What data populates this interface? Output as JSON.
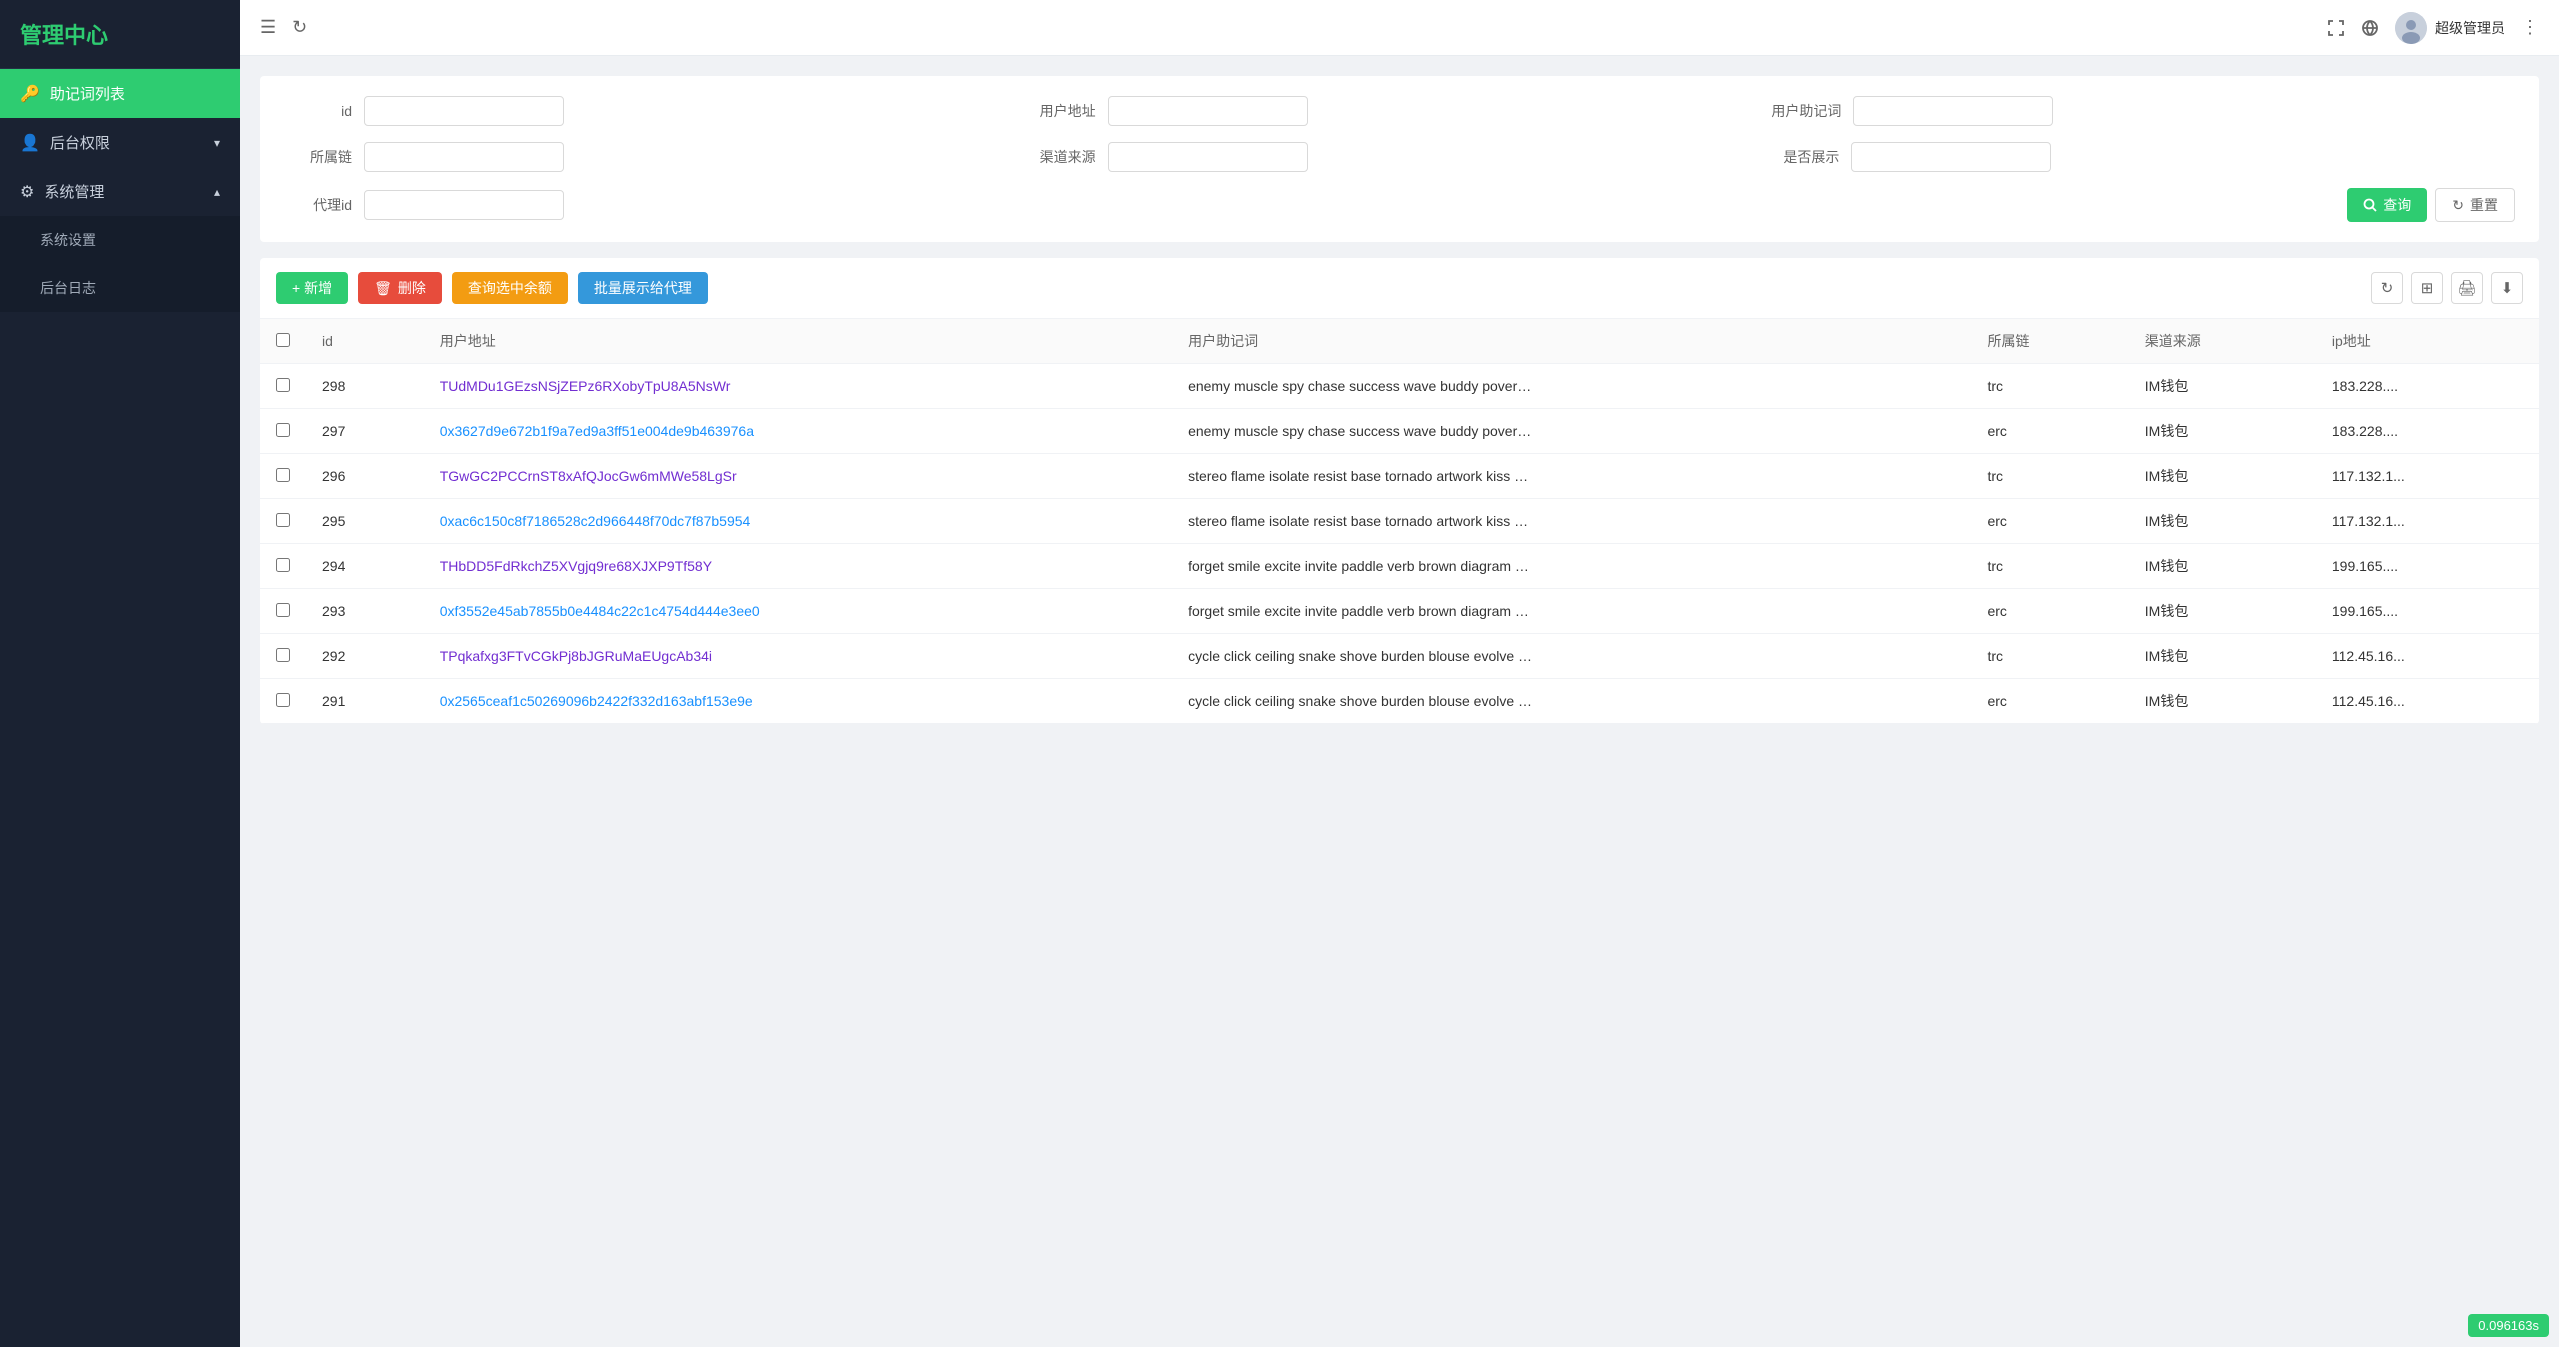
{
  "app": {
    "title": "管理中心"
  },
  "header": {
    "expand_icon": "☰",
    "refresh_icon": "↻",
    "fullscreen_icon": "⛶",
    "globe_icon": "🌐",
    "more_icon": "⋮",
    "user_name": "超级管理员"
  },
  "sidebar": {
    "logo": "管理中心",
    "items": [
      {
        "id": "mnemonic-list",
        "label": "助记词列表",
        "icon": "🔑",
        "active": true,
        "has_arrow": false
      },
      {
        "id": "backend-perm",
        "label": "后台权限",
        "icon": "👤",
        "active": false,
        "has_arrow": true,
        "expanded": false
      },
      {
        "id": "sys-manage",
        "label": "系统管理",
        "icon": "⚙",
        "active": false,
        "has_arrow": true,
        "expanded": true
      }
    ],
    "sub_items": [
      {
        "id": "sys-settings",
        "label": "系统设置"
      },
      {
        "id": "backend-log",
        "label": "后台日志"
      }
    ]
  },
  "search_form": {
    "fields": [
      {
        "id": "field-id",
        "label": "id",
        "placeholder": ""
      },
      {
        "id": "field-user-addr",
        "label": "用户地址",
        "placeholder": ""
      },
      {
        "id": "field-user-mnemonic",
        "label": "用户助记词",
        "placeholder": ""
      },
      {
        "id": "field-chain",
        "label": "所属链",
        "placeholder": ""
      },
      {
        "id": "field-channel",
        "label": "渠道来源",
        "placeholder": ""
      },
      {
        "id": "field-display",
        "label": "是否展示",
        "placeholder": ""
      },
      {
        "id": "field-agent-id",
        "label": "代理id",
        "placeholder": ""
      }
    ],
    "query_btn": "查询",
    "reset_btn": "重置"
  },
  "toolbar": {
    "add_btn": "+ 新增",
    "delete_btn": "删除",
    "query_selected_btn": "查询选中余额",
    "batch_display_btn": "批量展示给代理"
  },
  "table": {
    "columns": [
      "id",
      "用户地址",
      "用户助记词",
      "所属链",
      "渠道来源",
      "ip地址"
    ],
    "rows": [
      {
        "id": "298",
        "user_addr": "TUdMDu1GEzsNSjZEPz6RXobyTpU8A5NsWr",
        "mnemonic": "enemy muscle spy chase success wave buddy pover…",
        "chain": "trc",
        "channel": "IM钱包",
        "ip": "183.228...."
      },
      {
        "id": "297",
        "user_addr": "0x3627d9e672b1f9a7ed9a3ff51e004de9b463976a",
        "mnemonic": "enemy muscle spy chase success wave buddy pover…",
        "chain": "erc",
        "channel": "IM钱包",
        "ip": "183.228...."
      },
      {
        "id": "296",
        "user_addr": "TGwGC2PCCrnST8xAfQJocGw6mMWe58LgSr",
        "mnemonic": "stereo flame isolate resist base tornado artwork kiss …",
        "chain": "trc",
        "channel": "IM钱包",
        "ip": "117.132.1..."
      },
      {
        "id": "295",
        "user_addr": "0xac6c150c8f7186528c2d966448f70dc7f87b5954",
        "mnemonic": "stereo flame isolate resist base tornado artwork kiss …",
        "chain": "erc",
        "channel": "IM钱包",
        "ip": "117.132.1..."
      },
      {
        "id": "294",
        "user_addr": "THbDD5FdRkchZ5XVgjq9re68XJXP9Tf58Y",
        "mnemonic": "forget smile excite invite paddle verb brown diagram …",
        "chain": "trc",
        "channel": "IM钱包",
        "ip": "199.165...."
      },
      {
        "id": "293",
        "user_addr": "0xf3552e45ab7855b0e4484c22c1c4754d444e3ee0",
        "mnemonic": "forget smile excite invite paddle verb brown diagram …",
        "chain": "erc",
        "channel": "IM钱包",
        "ip": "199.165...."
      },
      {
        "id": "292",
        "user_addr": "TPqkafxg3FTvCGkPj8bJGRuMaEUgcAb34i",
        "mnemonic": "cycle click ceiling snake shove burden blouse evolve …",
        "chain": "trc",
        "channel": "IM钱包",
        "ip": "112.45.16..."
      },
      {
        "id": "291",
        "user_addr": "0x2565ceaf1c50269096b2422f332d163abf153e9e",
        "mnemonic": "cycle click ceiling snake shove burden blouse evolve …",
        "chain": "erc",
        "channel": "IM钱包",
        "ip": "112.45.16..."
      }
    ]
  },
  "status_bar": {
    "value": "0.096163s"
  }
}
